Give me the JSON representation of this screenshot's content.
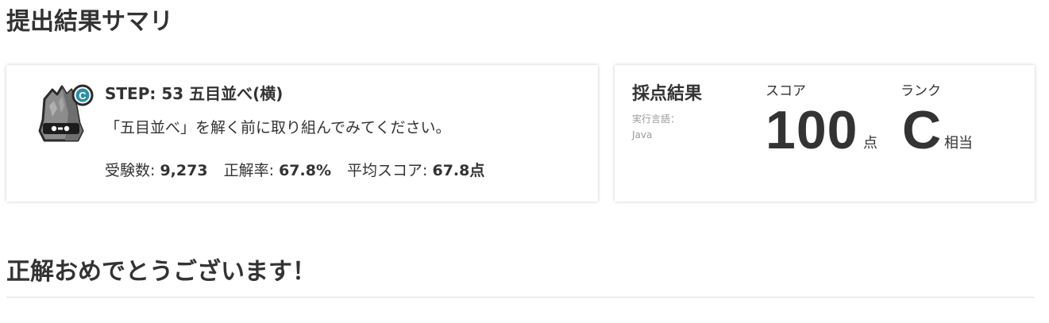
{
  "page_heading": "提出結果サマリ",
  "step": {
    "title": "STEP: 53 五目並べ(横)",
    "description": "「五目並べ」を解く前に取り組んでみてください。",
    "rank_badge": "C",
    "mascot_icon": "rock-monster-icon",
    "stats": {
      "examinees_label": "受験数:",
      "examinees_value": "9,273",
      "correct_rate_label": "正解率:",
      "correct_rate_value": "67.8%",
      "avg_score_label": "平均スコア:",
      "avg_score_value": "67.8点"
    }
  },
  "result": {
    "title": "採点結果",
    "language_label": "実行言語：",
    "language_value": "Java",
    "score_label": "スコア",
    "score_value": "100",
    "score_unit": "点",
    "rank_label": "ランク",
    "rank_value": "C",
    "rank_suffix": "相当"
  },
  "section_heading": "正解おめでとうございます！",
  "colors": {
    "text": "#333333",
    "muted": "#999999",
    "badge_accent": "#2a8fa8",
    "divider": "#dddddd"
  }
}
